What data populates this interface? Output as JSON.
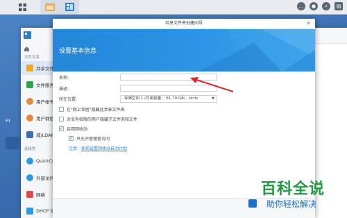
{
  "taskbar": {
    "apps": [
      {
        "name": "main-menu",
        "icon": "grid-icon"
      },
      {
        "name": "file-station",
        "icon": "folder-icon"
      },
      {
        "name": "control-panel",
        "icon": "control-panel-icon"
      }
    ],
    "right_icons": [
      "chat-icon",
      "user-icon",
      "search-icon",
      "widgets-icon"
    ]
  },
  "background_window": {
    "sidebar": {
      "groups": [
        {
          "label": "文件共享"
        },
        {
          "label": "连接性"
        }
      ],
      "items": [
        {
          "label": "共享文件夹",
          "color": "#f5a623",
          "selected": true
        },
        {
          "label": "文件服务",
          "color": "#2ea44f"
        },
        {
          "label": "用户帐号",
          "color": "#e8863a"
        },
        {
          "label": "用户群组",
          "color": "#e8863a"
        },
        {
          "label": "域/LDAP",
          "color": "#3b6fb0"
        },
        {
          "label": "QuickConnect",
          "color": "#2d9be0"
        },
        {
          "label": "外部访问",
          "color": "#2d9be0"
        },
        {
          "label": "网络",
          "color": "#e24a4a"
        },
        {
          "label": "DHCP Server",
          "color": "#2d9be0"
        }
      ]
    },
    "desktop_label": "Fil"
  },
  "dialog": {
    "title": "共享文件夹创建向导",
    "heading": "设置基本信息",
    "form": {
      "name_label": "名称:",
      "name_value": "",
      "desc_label": "描述:",
      "desc_value": "",
      "location_label": "所在位置:",
      "location_value": "存储空间 1 (可用容量： 81.79 GB) - btrfs"
    },
    "options": [
      {
        "label": "在\"网上邻居\"隐藏此共享文件夹",
        "checked": false
      },
      {
        "label": "对没有权限的用户隐藏子文件夹和文件",
        "checked": false
      },
      {
        "label": "启用回收站",
        "checked": true
      },
      {
        "label": "只允许管理者访问",
        "checked": true
      }
    ],
    "note": {
      "label": "注意：",
      "link": "如何设置回收站自动计划"
    }
  },
  "watermark": {
    "big": "百科全说",
    "small": "助你轻松解决"
  },
  "colors": {
    "accent": "#1e7cd6",
    "banner": "#2386d8",
    "arrow": "#d9262b",
    "watermark_green": "#1e9a3e"
  }
}
